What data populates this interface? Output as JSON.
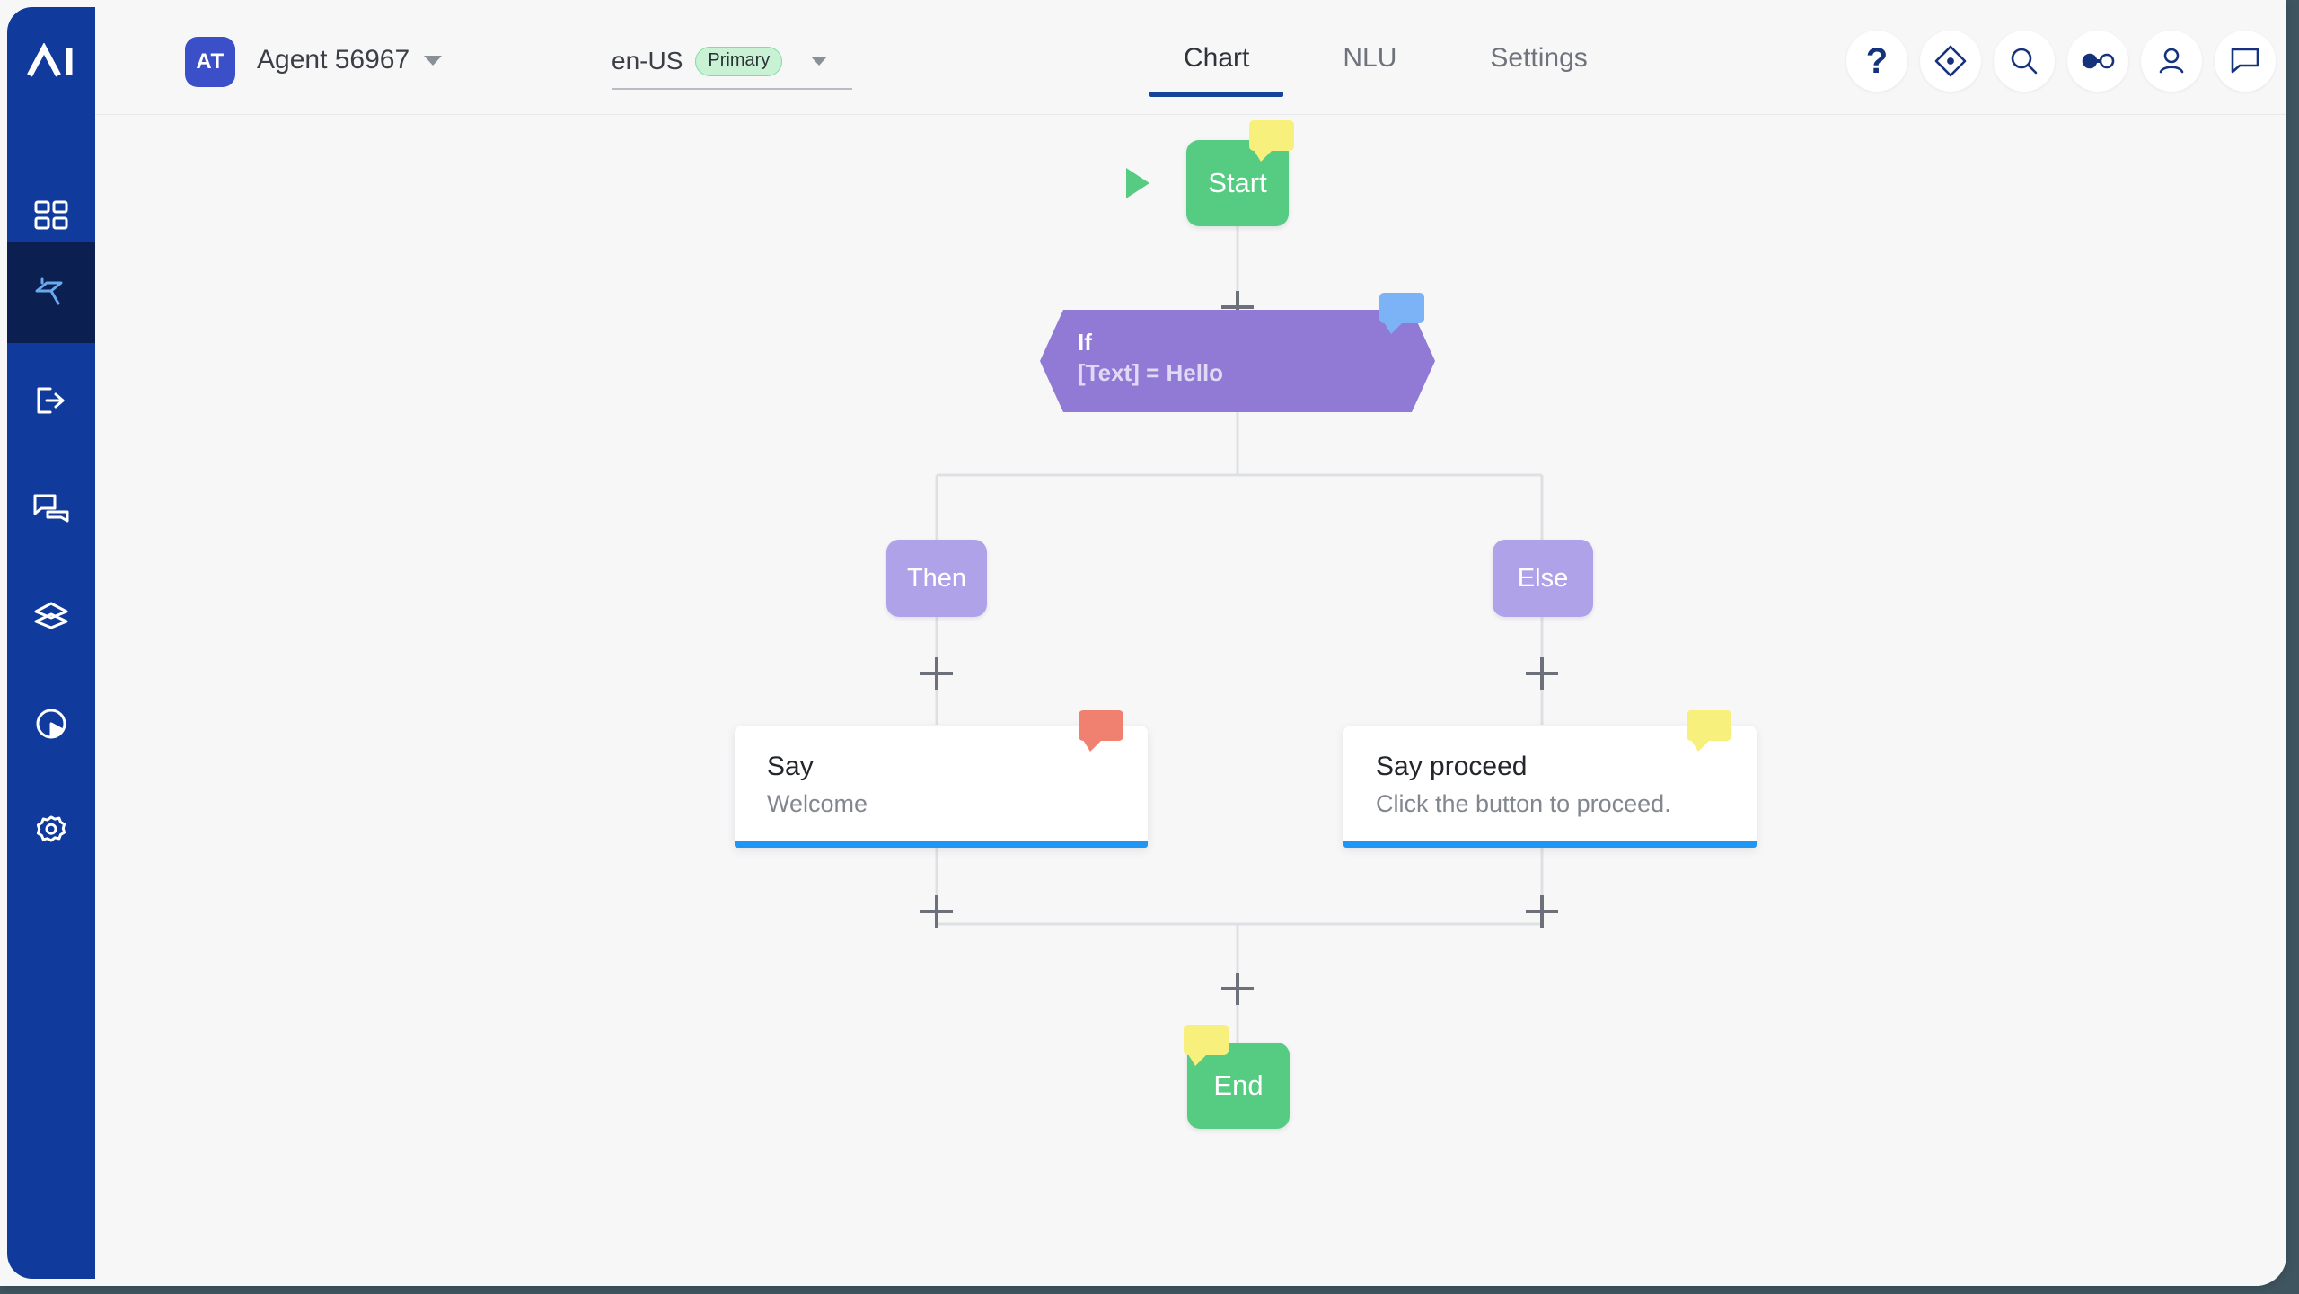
{
  "app": {
    "background": "#f7f7f8",
    "page_background": "#3f5560"
  },
  "sidebar": {
    "logo_label": "AI",
    "background": "#103a9b",
    "active_background": "#0b2050",
    "items": [
      {
        "name": "dashboard",
        "icon": "grid-icon",
        "label": "Dashboard",
        "active": false
      },
      {
        "name": "flow-builder",
        "icon": "paint-roller-icon",
        "label": "Flow Builder",
        "active": true
      },
      {
        "name": "export",
        "icon": "export-icon",
        "label": "Export",
        "active": false
      },
      {
        "name": "conversations",
        "icon": "conversations-icon",
        "label": "Conversations",
        "active": false
      },
      {
        "name": "layers",
        "icon": "layers-icon",
        "label": "Layers",
        "active": false
      },
      {
        "name": "analytics",
        "icon": "pie-chart-icon",
        "label": "Analytics",
        "active": false
      },
      {
        "name": "settings",
        "icon": "gear-icon",
        "label": "Settings",
        "active": false
      }
    ]
  },
  "header": {
    "brand_initials": "AT",
    "brand_color": "#3b50c8",
    "agent_name": "Agent 56967",
    "language": "en-US",
    "language_badge": "Primary",
    "badge_color": "#7fdda0",
    "tabs": [
      {
        "label": "Chart",
        "active": true
      },
      {
        "label": "NLU",
        "active": false
      },
      {
        "label": "Settings",
        "active": false
      }
    ],
    "active_tab_underline": "#16429a",
    "actions": [
      {
        "name": "help-button",
        "icon": "question-mark-icon",
        "label": "Help"
      },
      {
        "name": "explore-button",
        "icon": "compass-icon",
        "label": "Explore"
      },
      {
        "name": "search-button",
        "icon": "search-icon",
        "label": "Search"
      },
      {
        "name": "connect-button",
        "icon": "connection-toggle-icon",
        "label": "Connect"
      },
      {
        "name": "account-button",
        "icon": "user-icon",
        "label": "Account"
      },
      {
        "name": "messages-button",
        "icon": "chat-bubble-icon",
        "label": "Messages"
      }
    ]
  },
  "chart": {
    "nodes": {
      "start": {
        "label": "Start",
        "color": "#55cc81",
        "comment_color": "yellow"
      },
      "if": {
        "title": "If",
        "condition": "[Text] = Hello",
        "color": "#9179d6",
        "comment_color": "blue"
      },
      "then": {
        "label": "Then",
        "color": "#b0a2e8"
      },
      "else": {
        "label": "Else",
        "color": "#b0a2e8"
      },
      "say_then": {
        "title": "Say",
        "text": "Welcome",
        "accent": "#1f96f3",
        "comment_color": "red"
      },
      "say_else": {
        "title": "Say proceed",
        "text": "Click the button to proceed.",
        "accent": "#1f96f3",
        "comment_color": "yellow"
      },
      "end": {
        "label": "End",
        "color": "#55cc81",
        "comment_color": "yellow"
      }
    },
    "add_buttons": [
      {
        "name": "add-node-after-start"
      },
      {
        "name": "add-node-then-branch"
      },
      {
        "name": "add-node-else-branch"
      },
      {
        "name": "add-node-after-say-then"
      },
      {
        "name": "add-node-after-say-else"
      },
      {
        "name": "add-node-before-end"
      }
    ]
  }
}
